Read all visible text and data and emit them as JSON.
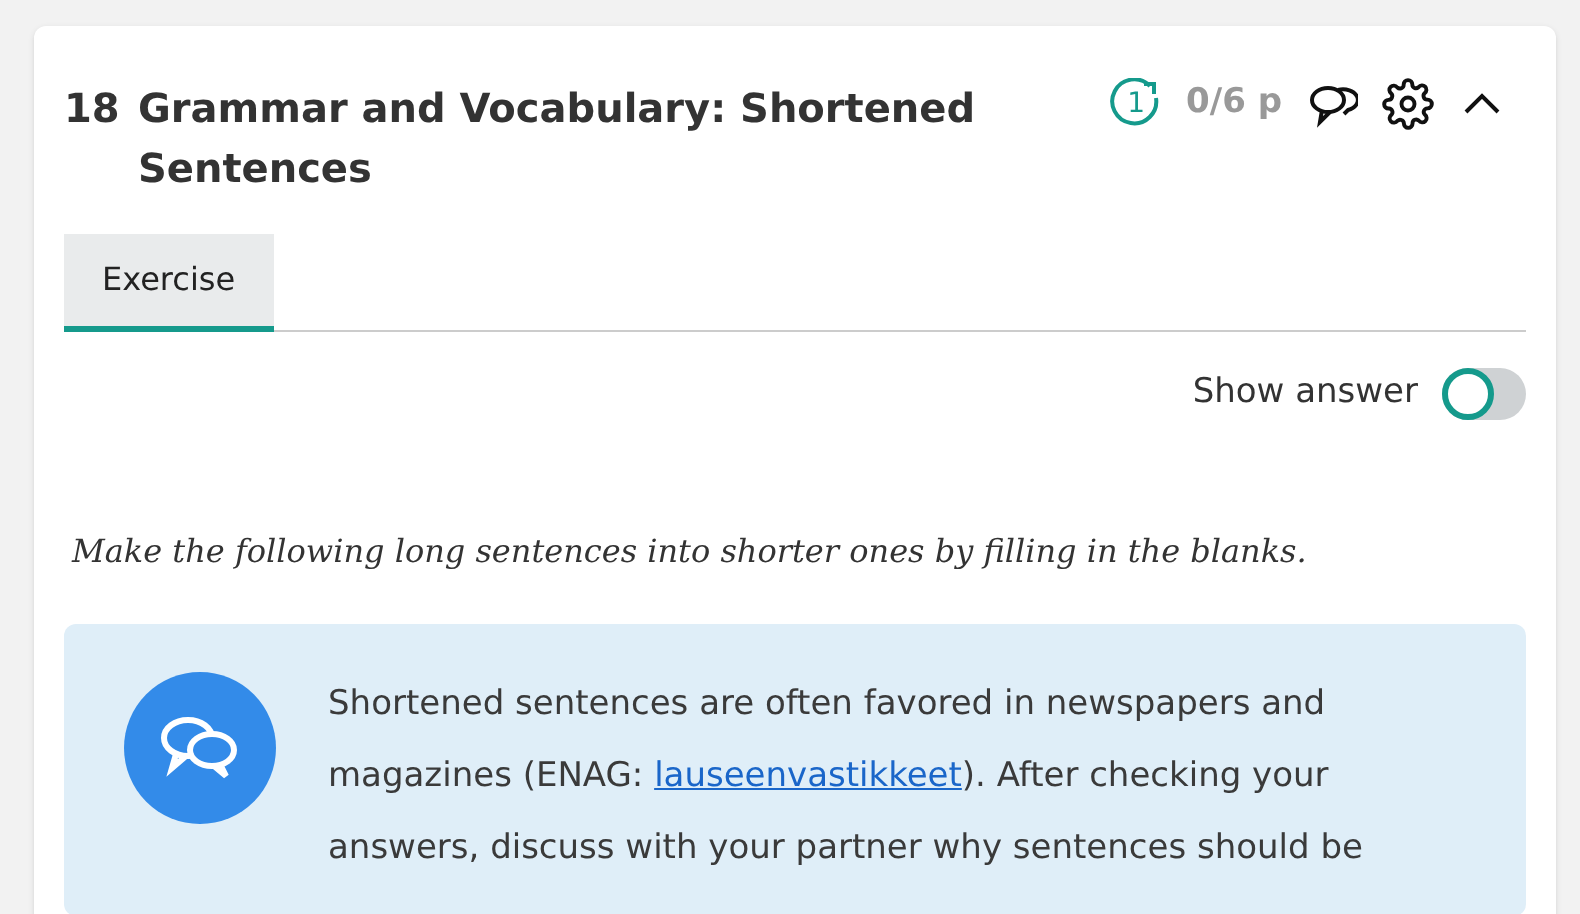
{
  "exercise": {
    "number": "18",
    "title": "Grammar and Vocabulary: Shortened Sentences",
    "attempts": "1",
    "score": "0/6 p",
    "expanded": true
  },
  "tabs": [
    {
      "label": "Exercise",
      "selected": true
    }
  ],
  "show_answer": {
    "label": "Show answer",
    "on": false
  },
  "instruction": "Make the following long sentences into shorter ones by filling in the blanks.",
  "info": {
    "before": "Shortened sentences are often favored in newspapers and magazines (ENAG: ",
    "link": "lauseenvastikkeet",
    "after": "). After checking your answers, discuss with your partner why sentences should be"
  }
}
